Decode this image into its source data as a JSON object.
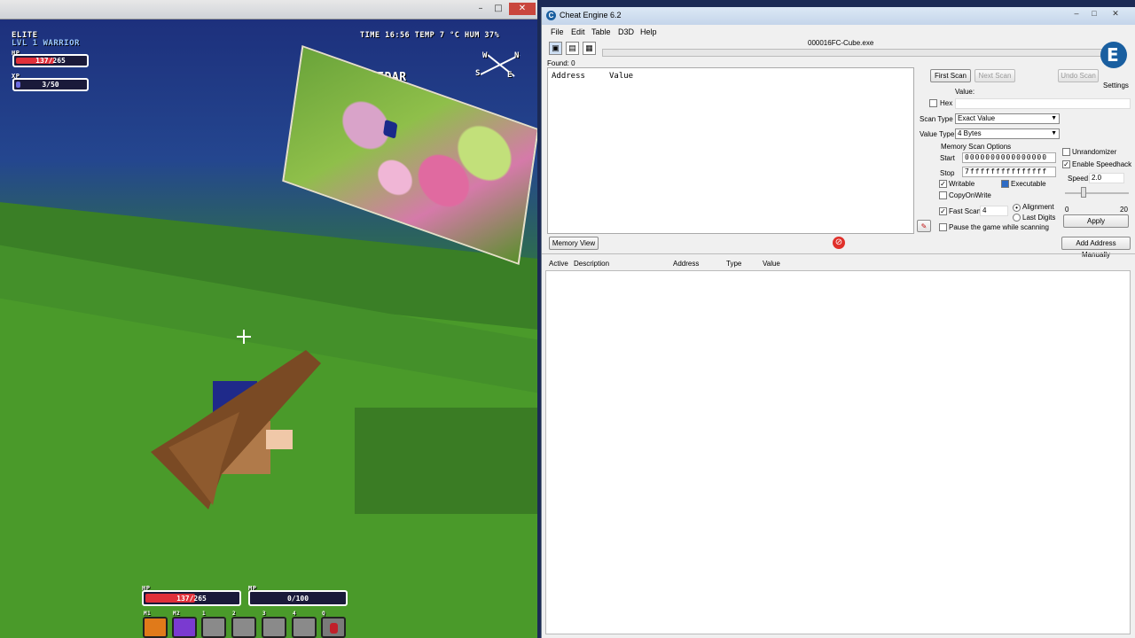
{
  "game": {
    "window_controls": [
      "–",
      "□",
      "✕"
    ],
    "hud": {
      "rank": "ELITE",
      "level_class": "LVL 1 WARRIOR",
      "hp_label": "HP",
      "hp_value": "137/265",
      "hp_fraction": 0.52,
      "xp_label": "XP",
      "xp_value": "3/50",
      "xp_fraction": 0.06,
      "time_temp_hum": "TIME 16:56  TEMP 7 °C  HUM 37%",
      "region": "LANDS OF SEDAR",
      "compass_letters": [
        "N",
        "S",
        "E",
        "W"
      ]
    },
    "bottom_hud": {
      "hp_label": "HP",
      "hp_value": "137/265",
      "mp_label": "MP",
      "mp_value": "0/100",
      "slot_labels": [
        "M1",
        "M2",
        "1",
        "2",
        "3",
        "4",
        "Q"
      ]
    }
  },
  "cheat_engine": {
    "title": "Cheat Engine 6.2",
    "window_controls": [
      "–",
      "□",
      "✕"
    ],
    "menu": [
      "File",
      "Edit",
      "Table",
      "D3D",
      "Help"
    ],
    "toolbar_icons": [
      "open-process-icon",
      "open-file-icon",
      "save-icon"
    ],
    "process_name": "000016FC-Cube.exe",
    "found": "Found: 0",
    "list_headers": [
      "Address",
      "Value"
    ],
    "buttons": {
      "first_scan": "First Scan",
      "next_scan": "Next Scan",
      "undo_scan": "Undo Scan",
      "settings": "Settings",
      "apply": "Apply",
      "memory_view": "Memory View",
      "add_address": "Add Address Manually"
    },
    "value_label": "Value:",
    "hex_label": "Hex",
    "scan_type_label": "Scan Type",
    "scan_type_value": "Exact Value",
    "value_type_label": "Value Type",
    "value_type_value": "4 Bytes",
    "memory_scan_options": "Memory Scan Options",
    "start_label": "Start",
    "start_value": "0000000000000000",
    "stop_label": "Stop",
    "stop_value": "7fffffffffffffff",
    "writable": "Writable",
    "executable": "Executable",
    "copy_on_write": "CopyOnWrite",
    "fast_scan": "Fast Scan",
    "fast_scan_value": "4",
    "alignment": "Alignment",
    "last_digits": "Last Digits",
    "pause_game": "Pause the game while scanning",
    "unrandomizer": "Unrandomizer",
    "enable_speedhack": "Enable Speedhack",
    "speed_label": "Speed",
    "speed_value": "2.0",
    "slider_min": "0",
    "slider_max": "20",
    "table_headers": [
      "Active",
      "Description",
      "Address",
      "Type",
      "Value"
    ]
  }
}
